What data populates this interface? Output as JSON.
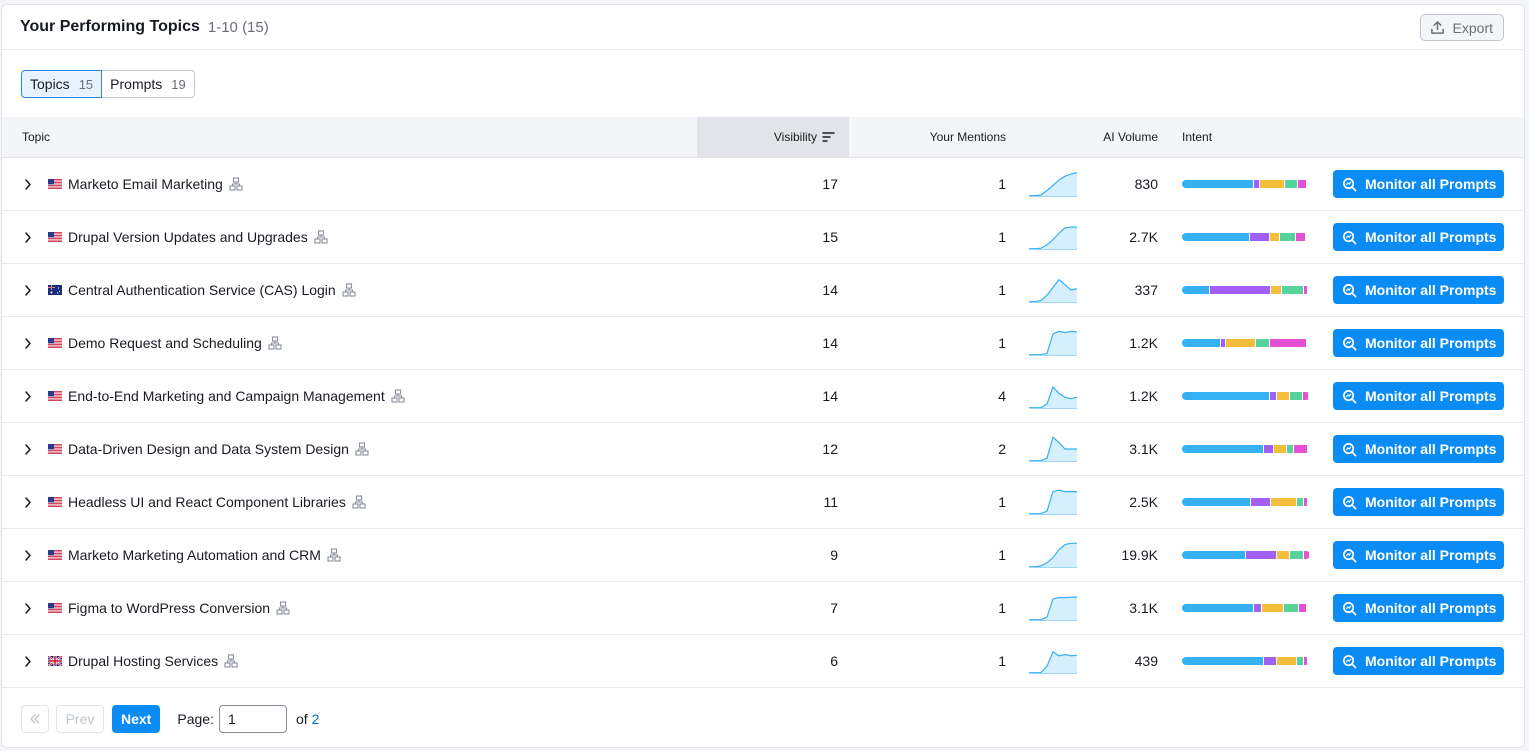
{
  "header": {
    "title": "Your Performing Topics",
    "range": "1-10 (15)",
    "export_label": "Export"
  },
  "tabs": [
    {
      "label": "Topics",
      "count": "15"
    },
    {
      "label": "Prompts",
      "count": "19"
    }
  ],
  "columns": {
    "topic": "Topic",
    "visibility": "Visibility",
    "mentions": "Your Mentions",
    "ai_volume": "AI Volume",
    "intent": "Intent"
  },
  "action_label": "Monitor all Prompts",
  "colors": {
    "accent": "#0b8cf5",
    "informational": "#35b0f3",
    "navigational": "#a25ff5",
    "commercial": "#f5bd3c",
    "transactional": "#56d39c",
    "pink": "#e452d3"
  },
  "rows": [
    {
      "flag": "us",
      "topic": "Marketo Email Marketing",
      "visibility": "17",
      "mentions": "1",
      "ai_volume": "830",
      "trend": [
        0.95,
        0.95,
        0.92,
        0.75,
        0.55,
        0.35,
        0.2,
        0.12,
        0.06
      ],
      "intent": [
        0.57,
        0.04,
        0.2,
        0.09,
        0.07
      ]
    },
    {
      "flag": "us",
      "topic": "Drupal Version Updates and Upgrades",
      "visibility": "15",
      "mentions": "1",
      "ai_volume": "2.7K",
      "trend": [
        0.95,
        0.95,
        0.93,
        0.8,
        0.6,
        0.35,
        0.15,
        0.12,
        0.12
      ],
      "intent": [
        0.54,
        0.15,
        0.08,
        0.12,
        0.07
      ]
    },
    {
      "flag": "au",
      "topic": "Central Authentication Service (CAS) Login",
      "visibility": "14",
      "mentions": "1",
      "ai_volume": "337",
      "trend": [
        0.95,
        0.95,
        0.9,
        0.7,
        0.4,
        0.1,
        0.3,
        0.5,
        0.45
      ],
      "intent": [
        0.22,
        0.48,
        0.08,
        0.17,
        0.03
      ]
    },
    {
      "flag": "us",
      "topic": "Demo Request and Scheduling",
      "visibility": "14",
      "mentions": "1",
      "ai_volume": "1.2K",
      "trend": [
        0.95,
        0.95,
        0.95,
        0.9,
        0.15,
        0.05,
        0.1,
        0.05,
        0.08
      ],
      "intent": [
        0.31,
        0.03,
        0.23,
        0.11,
        0.29
      ]
    },
    {
      "flag": "us",
      "topic": "End-to-End Marketing and Campaign Management",
      "visibility": "14",
      "mentions": "4",
      "ai_volume": "1.2K",
      "trend": [
        0.95,
        0.95,
        0.95,
        0.8,
        0.15,
        0.4,
        0.55,
        0.6,
        0.55
      ],
      "intent": [
        0.7,
        0.05,
        0.1,
        0.09,
        0.04
      ]
    },
    {
      "flag": "us",
      "topic": "Data-Driven Design and Data System Design",
      "visibility": "12",
      "mentions": "2",
      "ai_volume": "3.1K",
      "trend": [
        0.95,
        0.95,
        0.95,
        0.85,
        0.05,
        0.25,
        0.5,
        0.5,
        0.5
      ],
      "intent": [
        0.65,
        0.08,
        0.09,
        0.05,
        0.11
      ]
    },
    {
      "flag": "us",
      "topic": "Headless UI and React Component Libraries",
      "visibility": "11",
      "mentions": "1",
      "ai_volume": "2.5K",
      "trend": [
        0.95,
        0.95,
        0.95,
        0.85,
        0.1,
        0.05,
        0.1,
        0.1,
        0.1
      ],
      "intent": [
        0.55,
        0.15,
        0.2,
        0.05,
        0.03
      ]
    },
    {
      "flag": "us",
      "topic": "Marketo Marketing Automation and CRM",
      "visibility": "9",
      "mentions": "1",
      "ai_volume": "19.9K",
      "trend": [
        0.95,
        0.95,
        0.92,
        0.8,
        0.6,
        0.3,
        0.1,
        0.05,
        0.05
      ],
      "intent": [
        0.51,
        0.24,
        0.1,
        0.1,
        0.04
      ]
    },
    {
      "flag": "us",
      "topic": "Figma to WordPress Conversion",
      "visibility": "7",
      "mentions": "1",
      "ai_volume": "3.1K",
      "trend": [
        0.95,
        0.95,
        0.95,
        0.85,
        0.15,
        0.1,
        0.1,
        0.08,
        0.08
      ],
      "intent": [
        0.57,
        0.06,
        0.17,
        0.11,
        0.06
      ]
    },
    {
      "flag": "gb",
      "topic": "Drupal Hosting Services",
      "visibility": "6",
      "mentions": "1",
      "ai_volume": "439",
      "trend": [
        0.95,
        0.95,
        0.95,
        0.7,
        0.15,
        0.3,
        0.25,
        0.3,
        0.28
      ],
      "intent": [
        0.65,
        0.1,
        0.15,
        0.05,
        0.03
      ]
    }
  ],
  "pager": {
    "prev_label": "Prev",
    "next_label": "Next",
    "page_label": "Page:",
    "page_value": "1",
    "of_label": "of",
    "total_pages": "2"
  }
}
